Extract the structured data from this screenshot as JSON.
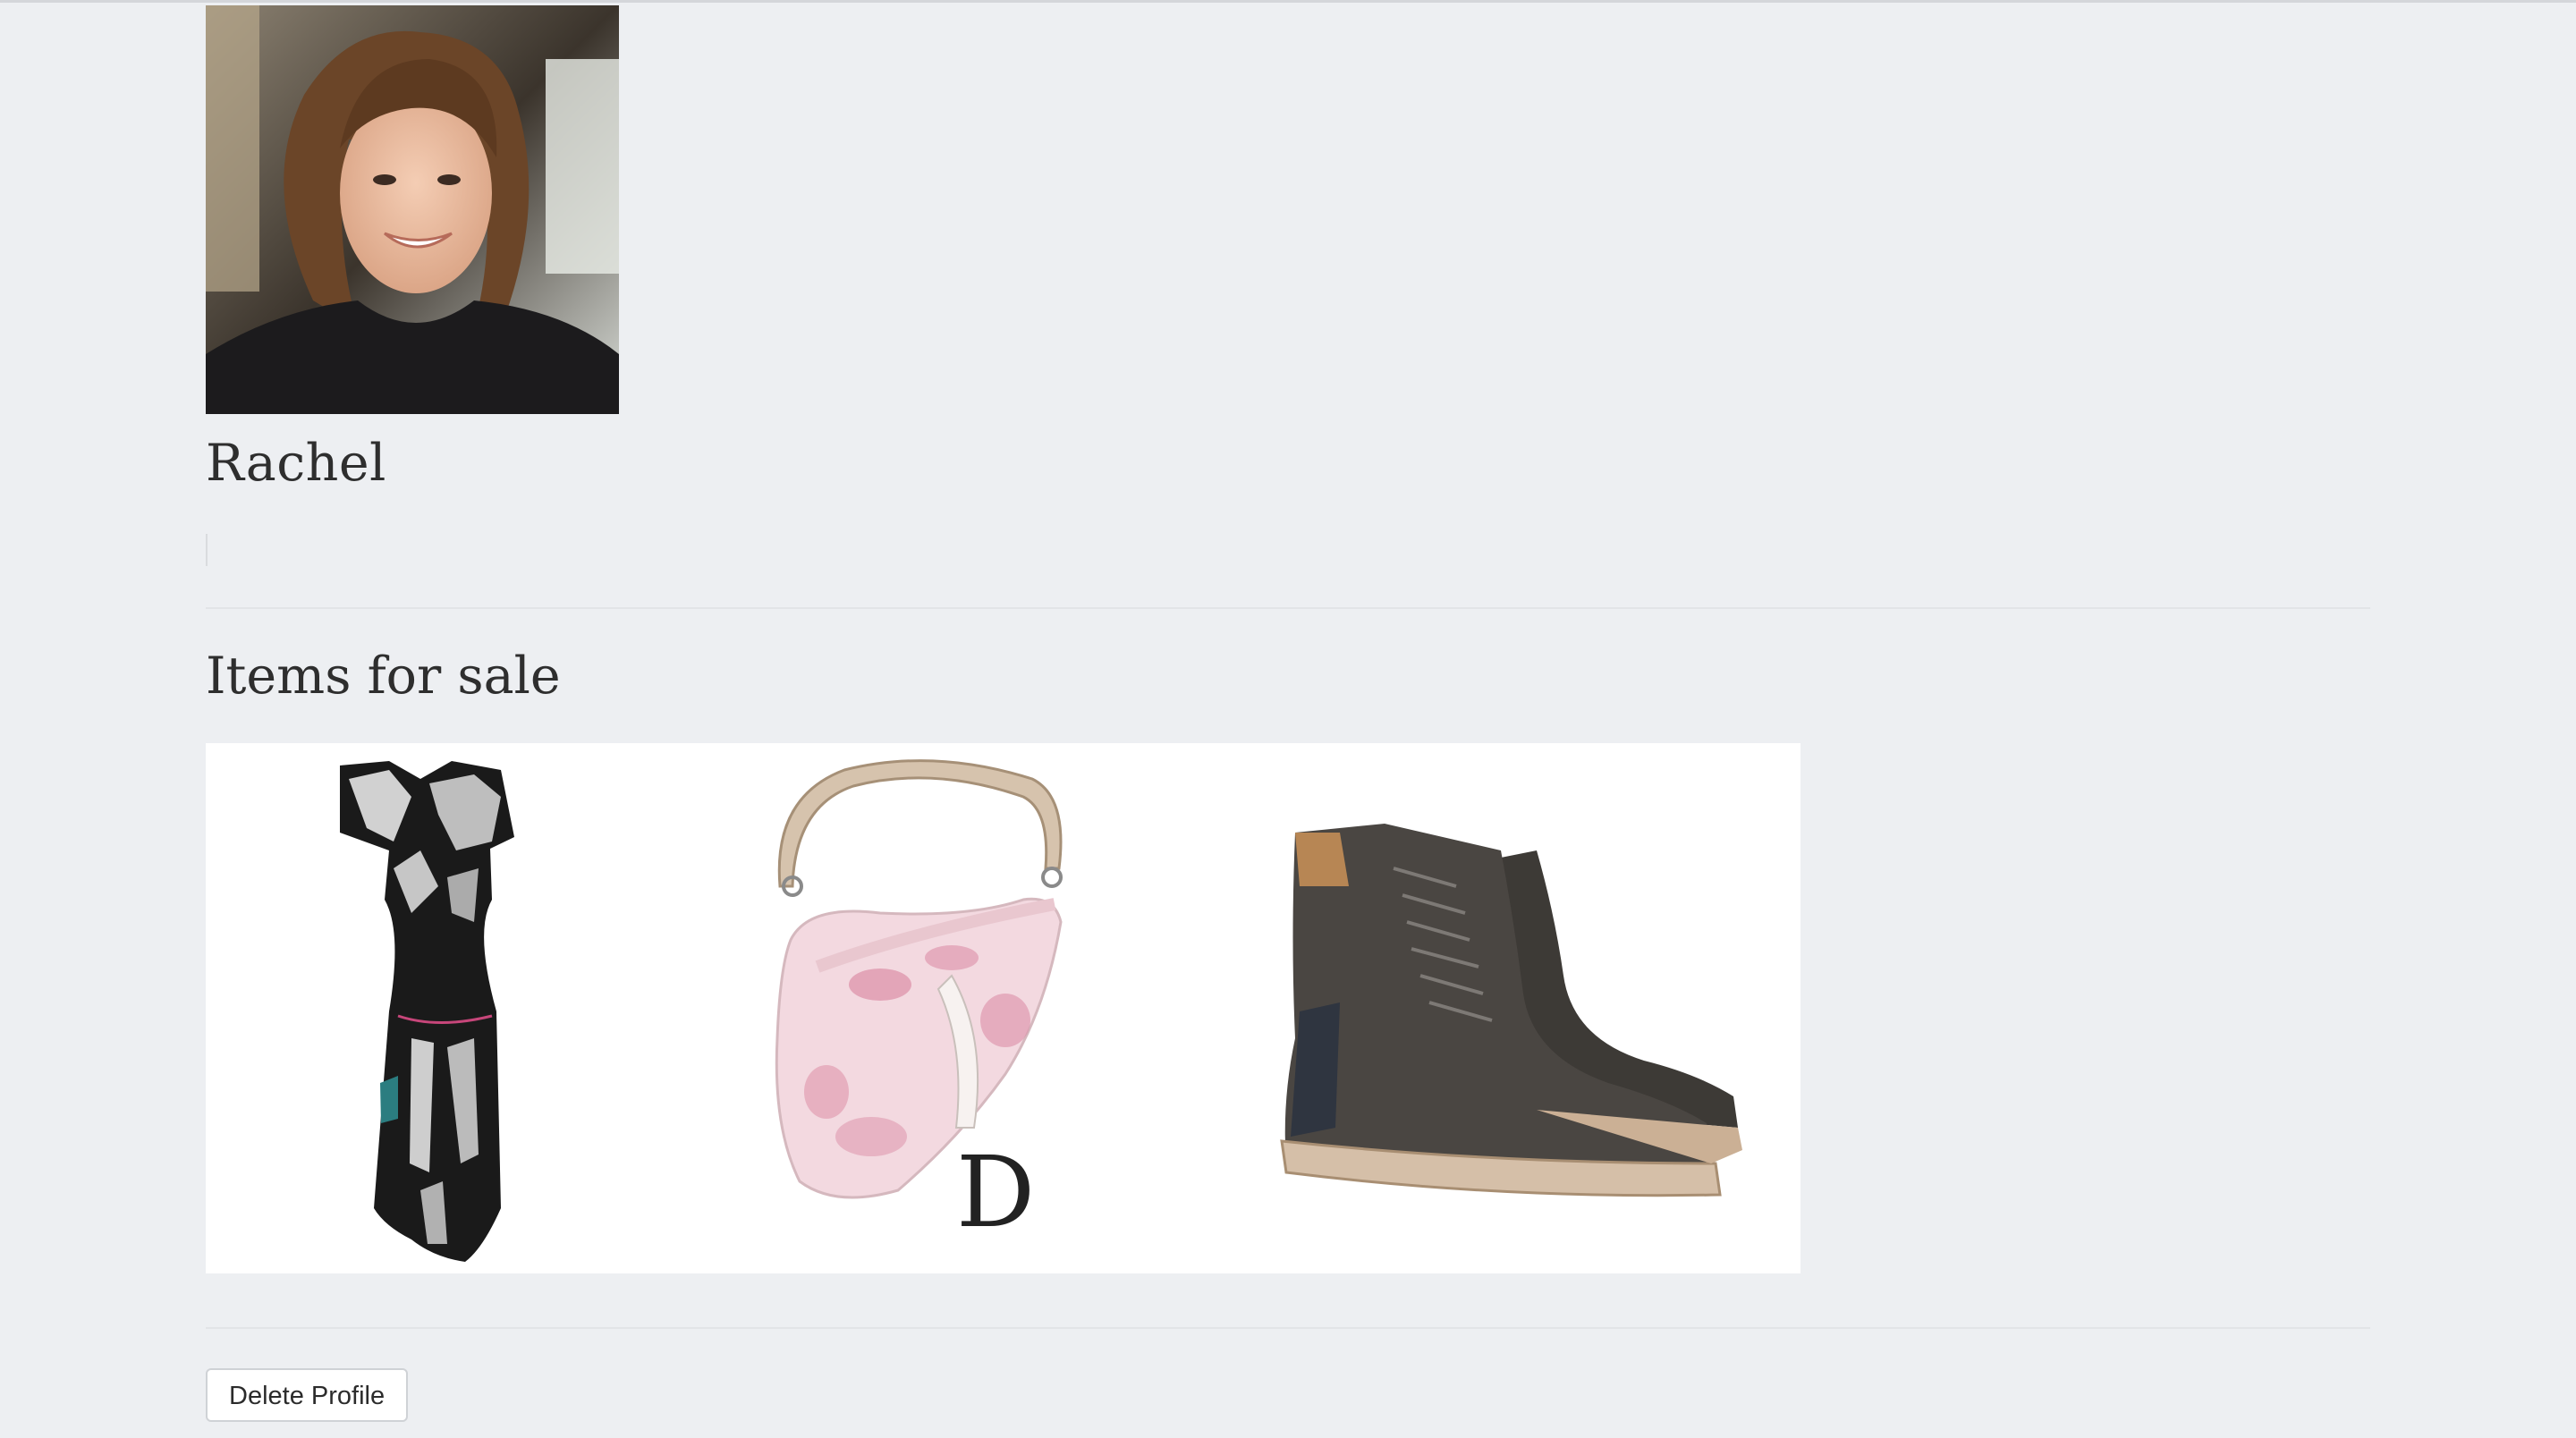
{
  "profile": {
    "name": "Rachel",
    "bio": ""
  },
  "items_section": {
    "title": "Items for sale",
    "items": [
      {
        "id": "dress",
        "icon": "printed-dress-image"
      },
      {
        "id": "bag",
        "icon": "saddle-bag-image"
      },
      {
        "id": "boots",
        "icon": "suede-boots-image"
      }
    ]
  },
  "actions": {
    "delete_label": "Delete Profile"
  },
  "colors": {
    "background": "#edeff2",
    "text": "#2e2e2e",
    "divider": "#e2e4e7"
  }
}
